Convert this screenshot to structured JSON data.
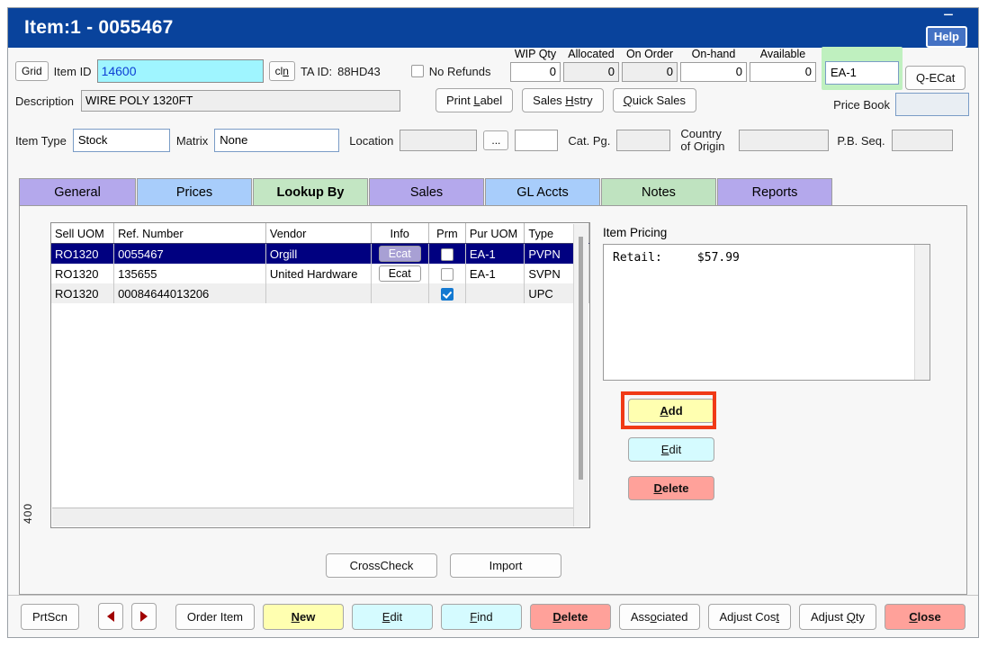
{
  "window": {
    "title": "Item:1 - 0055467",
    "help_label": "Help",
    "minimize_glyph": "−"
  },
  "header": {
    "grid_button": "Grid",
    "item_id_label": "Item ID",
    "item_id_value": "14600",
    "cln_button": "cln",
    "ta_id_label": "TA ID:",
    "ta_id_value": "88HD43",
    "no_refunds_label": "No Refunds",
    "no_refunds_checked": false,
    "description_label": "Description",
    "description_value": "WIRE POLY 1320FT",
    "print_label_button": "Print Label",
    "sales_hstry_button": "Sales Hstry",
    "quick_sales_button": "Quick Sales",
    "item_type_label": "Item Type",
    "item_type_value": "Stock",
    "matrix_label": "Matrix",
    "matrix_value": "None",
    "location_label": "Location",
    "location_value": "",
    "ellipsis_button": "...",
    "location_extra_value": "",
    "cat_pg_label": "Cat. Pg.",
    "cat_pg_value": "",
    "country_of_origin_label": "Country of Origin",
    "country_of_origin_value": "",
    "pb_seq_label": "P.B. Seq.",
    "pb_seq_value": "",
    "price_book_label": "Price Book",
    "price_book_value": "",
    "uom_value": "EA-1",
    "qecat_button": "Q-ECat",
    "quantities": [
      {
        "label": "WIP Qty",
        "value": "0",
        "readonly": false
      },
      {
        "label": "Allocated",
        "value": "0",
        "readonly": true
      },
      {
        "label": "On Order",
        "value": "0",
        "readonly": true
      },
      {
        "label": "On-hand",
        "value": "0",
        "readonly": false
      },
      {
        "label": "Available",
        "value": "0",
        "readonly": false
      }
    ]
  },
  "tabs": [
    {
      "label": "General",
      "color": "purple",
      "active": false
    },
    {
      "label": "Prices",
      "color": "blue",
      "active": false
    },
    {
      "label": "Lookup By",
      "color": "green",
      "active": true
    },
    {
      "label": "Sales",
      "color": "purple",
      "active": false
    },
    {
      "label": "GL Accts",
      "color": "blue",
      "active": false
    },
    {
      "label": "Notes",
      "color": "green",
      "active": false
    },
    {
      "label": "Reports",
      "color": "purple",
      "active": false
    }
  ],
  "lookup_grid": {
    "columns": [
      "Sell UOM",
      "Ref. Number",
      "Vendor",
      "Info",
      "Prm",
      "Pur UOM",
      "Type"
    ],
    "rows": [
      {
        "sell_uom": "RO1320",
        "ref_number": "0055467",
        "vendor": "Orgill",
        "info": "Ecat",
        "prm_checked": false,
        "pur_uom": "EA-1",
        "type": "PVPN",
        "selected": true,
        "shaded": false
      },
      {
        "sell_uom": "RO1320",
        "ref_number": "135655",
        "vendor": "United Hardware",
        "info": "Ecat",
        "prm_checked": false,
        "pur_uom": "EA-1",
        "type": "SVPN",
        "selected": false,
        "shaded": false
      },
      {
        "sell_uom": "RO1320",
        "ref_number": "00084644013206",
        "vendor": "",
        "info": "",
        "prm_checked": true,
        "pur_uom": "",
        "type": "UPC",
        "selected": false,
        "shaded": true
      }
    ],
    "side_label": "400",
    "crosscheck_button": "CrossCheck",
    "import_button": "Import"
  },
  "item_pricing": {
    "title": "Item Pricing",
    "text": "Retail:     $57.99",
    "add_button": "Add",
    "edit_button": "Edit",
    "delete_button": "Delete",
    "add_highlight_color": "#f03a16"
  },
  "toolbar": {
    "prtscn_button": "PrtScn",
    "prev_button": "prev-arrow",
    "next_button": "next-arrow",
    "order_item_button": "Order Item",
    "new_button": "New",
    "edit_button": "Edit",
    "find_button": "Find",
    "delete_button": "Delete",
    "associated_button": "Associated",
    "adjust_cost_button": "Adjust Cost",
    "adjust_qty_button": "Adjust Qty",
    "close_button": "Close"
  },
  "colors": {
    "titlebar": "#09439c",
    "tab_purple": "#b4a8ec",
    "tab_blue": "#a8cdfb",
    "tab_green": "#c3e6c3",
    "selected_row": "#000080",
    "yellow_button": "#ffffb0",
    "cyan_button": "#d5fbff",
    "red_button": "#ffa19a",
    "item_id_field": "#9ff5ff",
    "uom_highlight": "#bff0bf"
  }
}
